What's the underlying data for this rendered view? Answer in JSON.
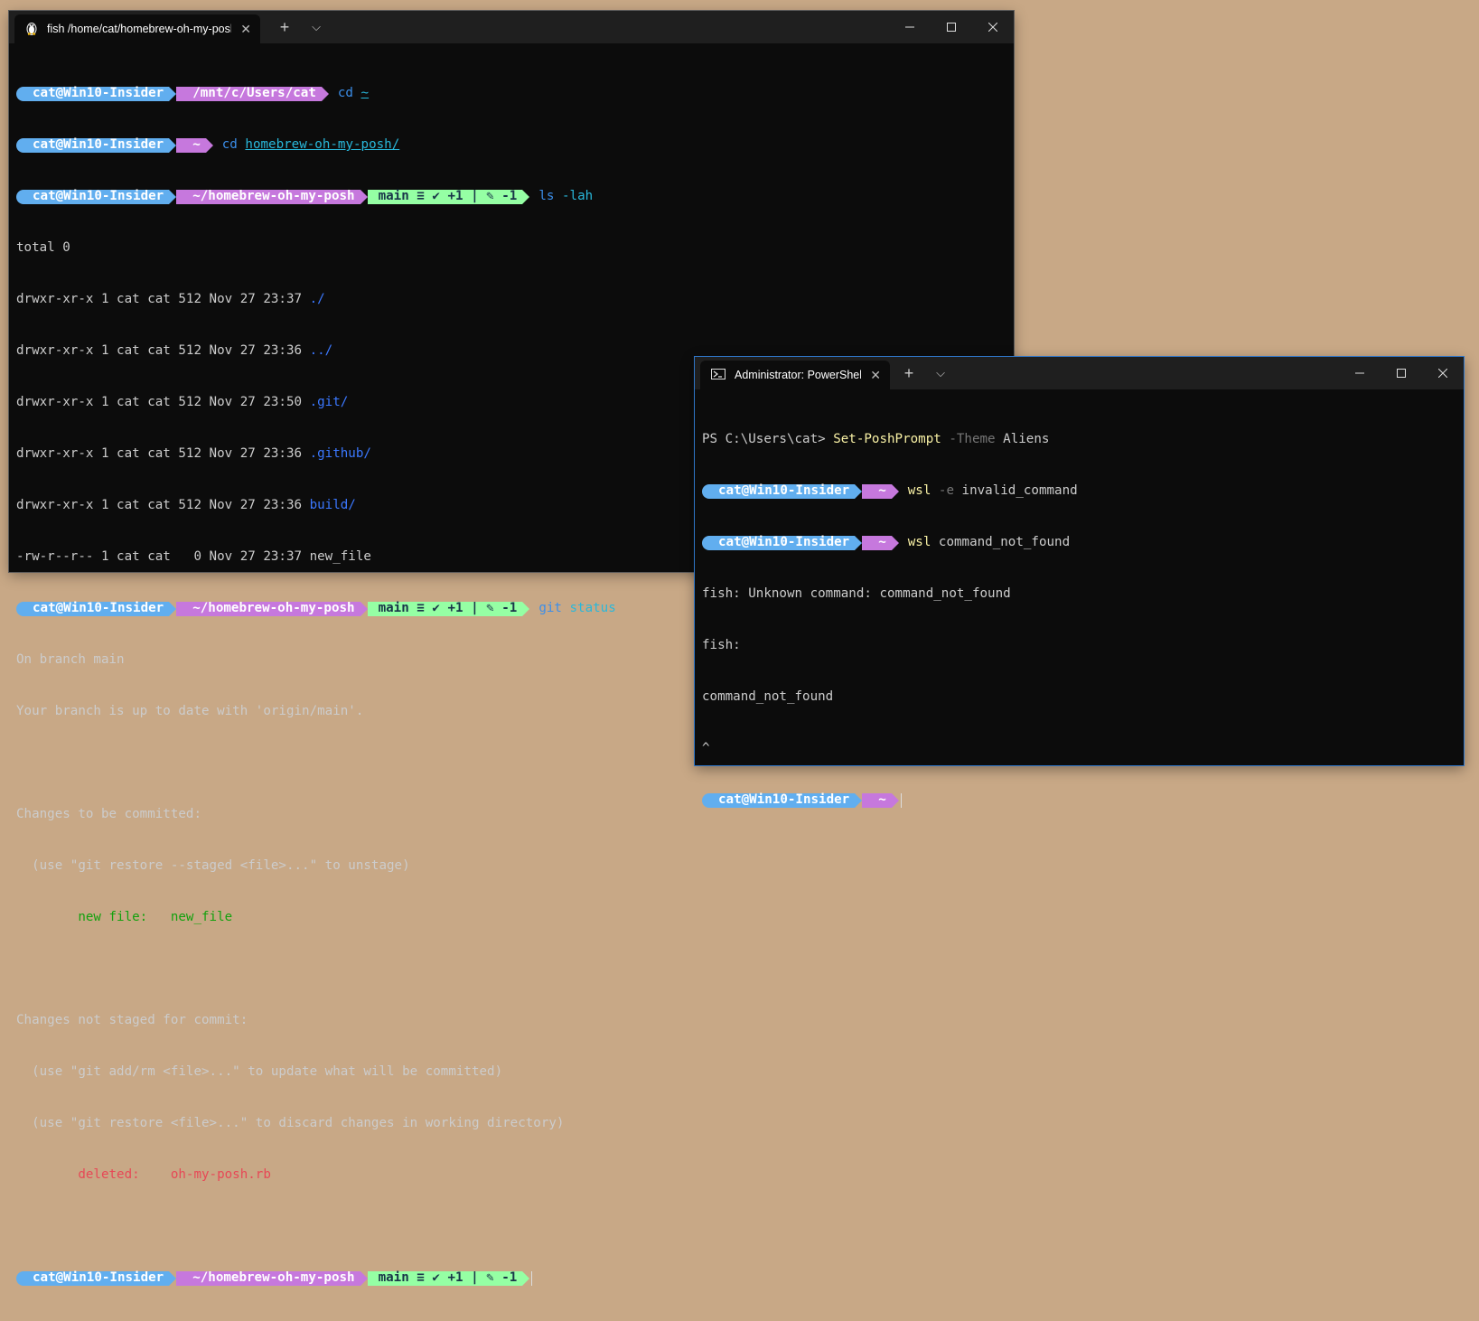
{
  "window1": {
    "tab_title": "fish /home/cat/homebrew-oh-my-posh",
    "lines": {
      "l1": {
        "user": "cat@Win10-Insider",
        "path": "/mnt/c/Users/cat",
        "cmd": "cd",
        "arg": "~"
      },
      "l2": {
        "user": "cat@Win10-Insider",
        "path": "~",
        "cmd": "cd",
        "arg": "homebrew-oh-my-posh/"
      },
      "l3": {
        "user": "cat@Win10-Insider",
        "path": "~/homebrew-oh-my-posh",
        "git": "main ≡ ✔ +1 | ✎ -1",
        "cmd": "ls",
        "arg": "-lah"
      },
      "total": "total 0",
      "ls": [
        {
          "meta": "drwxr-xr-x 1 cat cat 512 Nov 27 23:37 ",
          "name": "./",
          "kind": "dir"
        },
        {
          "meta": "drwxr-xr-x 1 cat cat 512 Nov 27 23:36 ",
          "name": "../",
          "kind": "dir"
        },
        {
          "meta": "drwxr-xr-x 1 cat cat 512 Nov 27 23:50 ",
          "name": ".git/",
          "kind": "dir"
        },
        {
          "meta": "drwxr-xr-x 1 cat cat 512 Nov 27 23:36 ",
          "name": ".github/",
          "kind": "dir"
        },
        {
          "meta": "drwxr-xr-x 1 cat cat 512 Nov 27 23:36 ",
          "name": "build/",
          "kind": "dir"
        },
        {
          "meta": "-rw-r--r-- 1 cat cat   0 Nov 27 23:37 ",
          "name": "new_file",
          "kind": "file"
        }
      ],
      "l4": {
        "user": "cat@Win10-Insider",
        "path": "~/homebrew-oh-my-posh",
        "git": "main ≡ ✔ +1 | ✎ -1",
        "cmd": "git",
        "arg": "status"
      },
      "out1": "On branch main",
      "out2": "Your branch is up to date with 'origin/main'.",
      "out3": "Changes to be committed:",
      "out4": "  (use \"git restore --staged <file>...\" to unstage)",
      "out5_label": "        new file:   ",
      "out5_file": "new_file",
      "out6": "Changes not staged for commit:",
      "out7": "  (use \"git add/rm <file>...\" to update what will be committed)",
      "out8": "  (use \"git restore <file>...\" to discard changes in working directory)",
      "out9_label": "        deleted:    ",
      "out9_file": "oh-my-posh.rb",
      "l5": {
        "user": "cat@Win10-Insider",
        "path": "~/homebrew-oh-my-posh",
        "git": "main ≡ ✔ +1 | ✎ -1"
      }
    }
  },
  "window2": {
    "tab_title": "Administrator: PowerShell",
    "ps_prefix": "PS C:\\Users\\cat> ",
    "ps_cmd": "Set-PoshPrompt",
    "ps_flag": " -Theme",
    "ps_val": " Aliens",
    "l2": {
      "user": "cat@Win10-Insider",
      "path": "~",
      "cmd": "wsl",
      "arg": " -e",
      "rest": " invalid_command"
    },
    "l3": {
      "user": "cat@Win10-Insider",
      "path": "~",
      "cmd": "wsl",
      "rest": " command_not_found"
    },
    "o1": "fish: Unknown command: command_not_found",
    "o2": "fish:",
    "o3": "command_not_found",
    "o4": "^",
    "l4": {
      "user": "cat@Win10-Insider",
      "path": "~"
    }
  },
  "icons": {
    "linux": "linux-penguin-icon",
    "powershell": "powershell-icon"
  },
  "colors": {
    "user_segment": "#61aeef",
    "path_segment": "#c678dd",
    "git_segment": "#95ffa4",
    "background": "#c8a886"
  }
}
